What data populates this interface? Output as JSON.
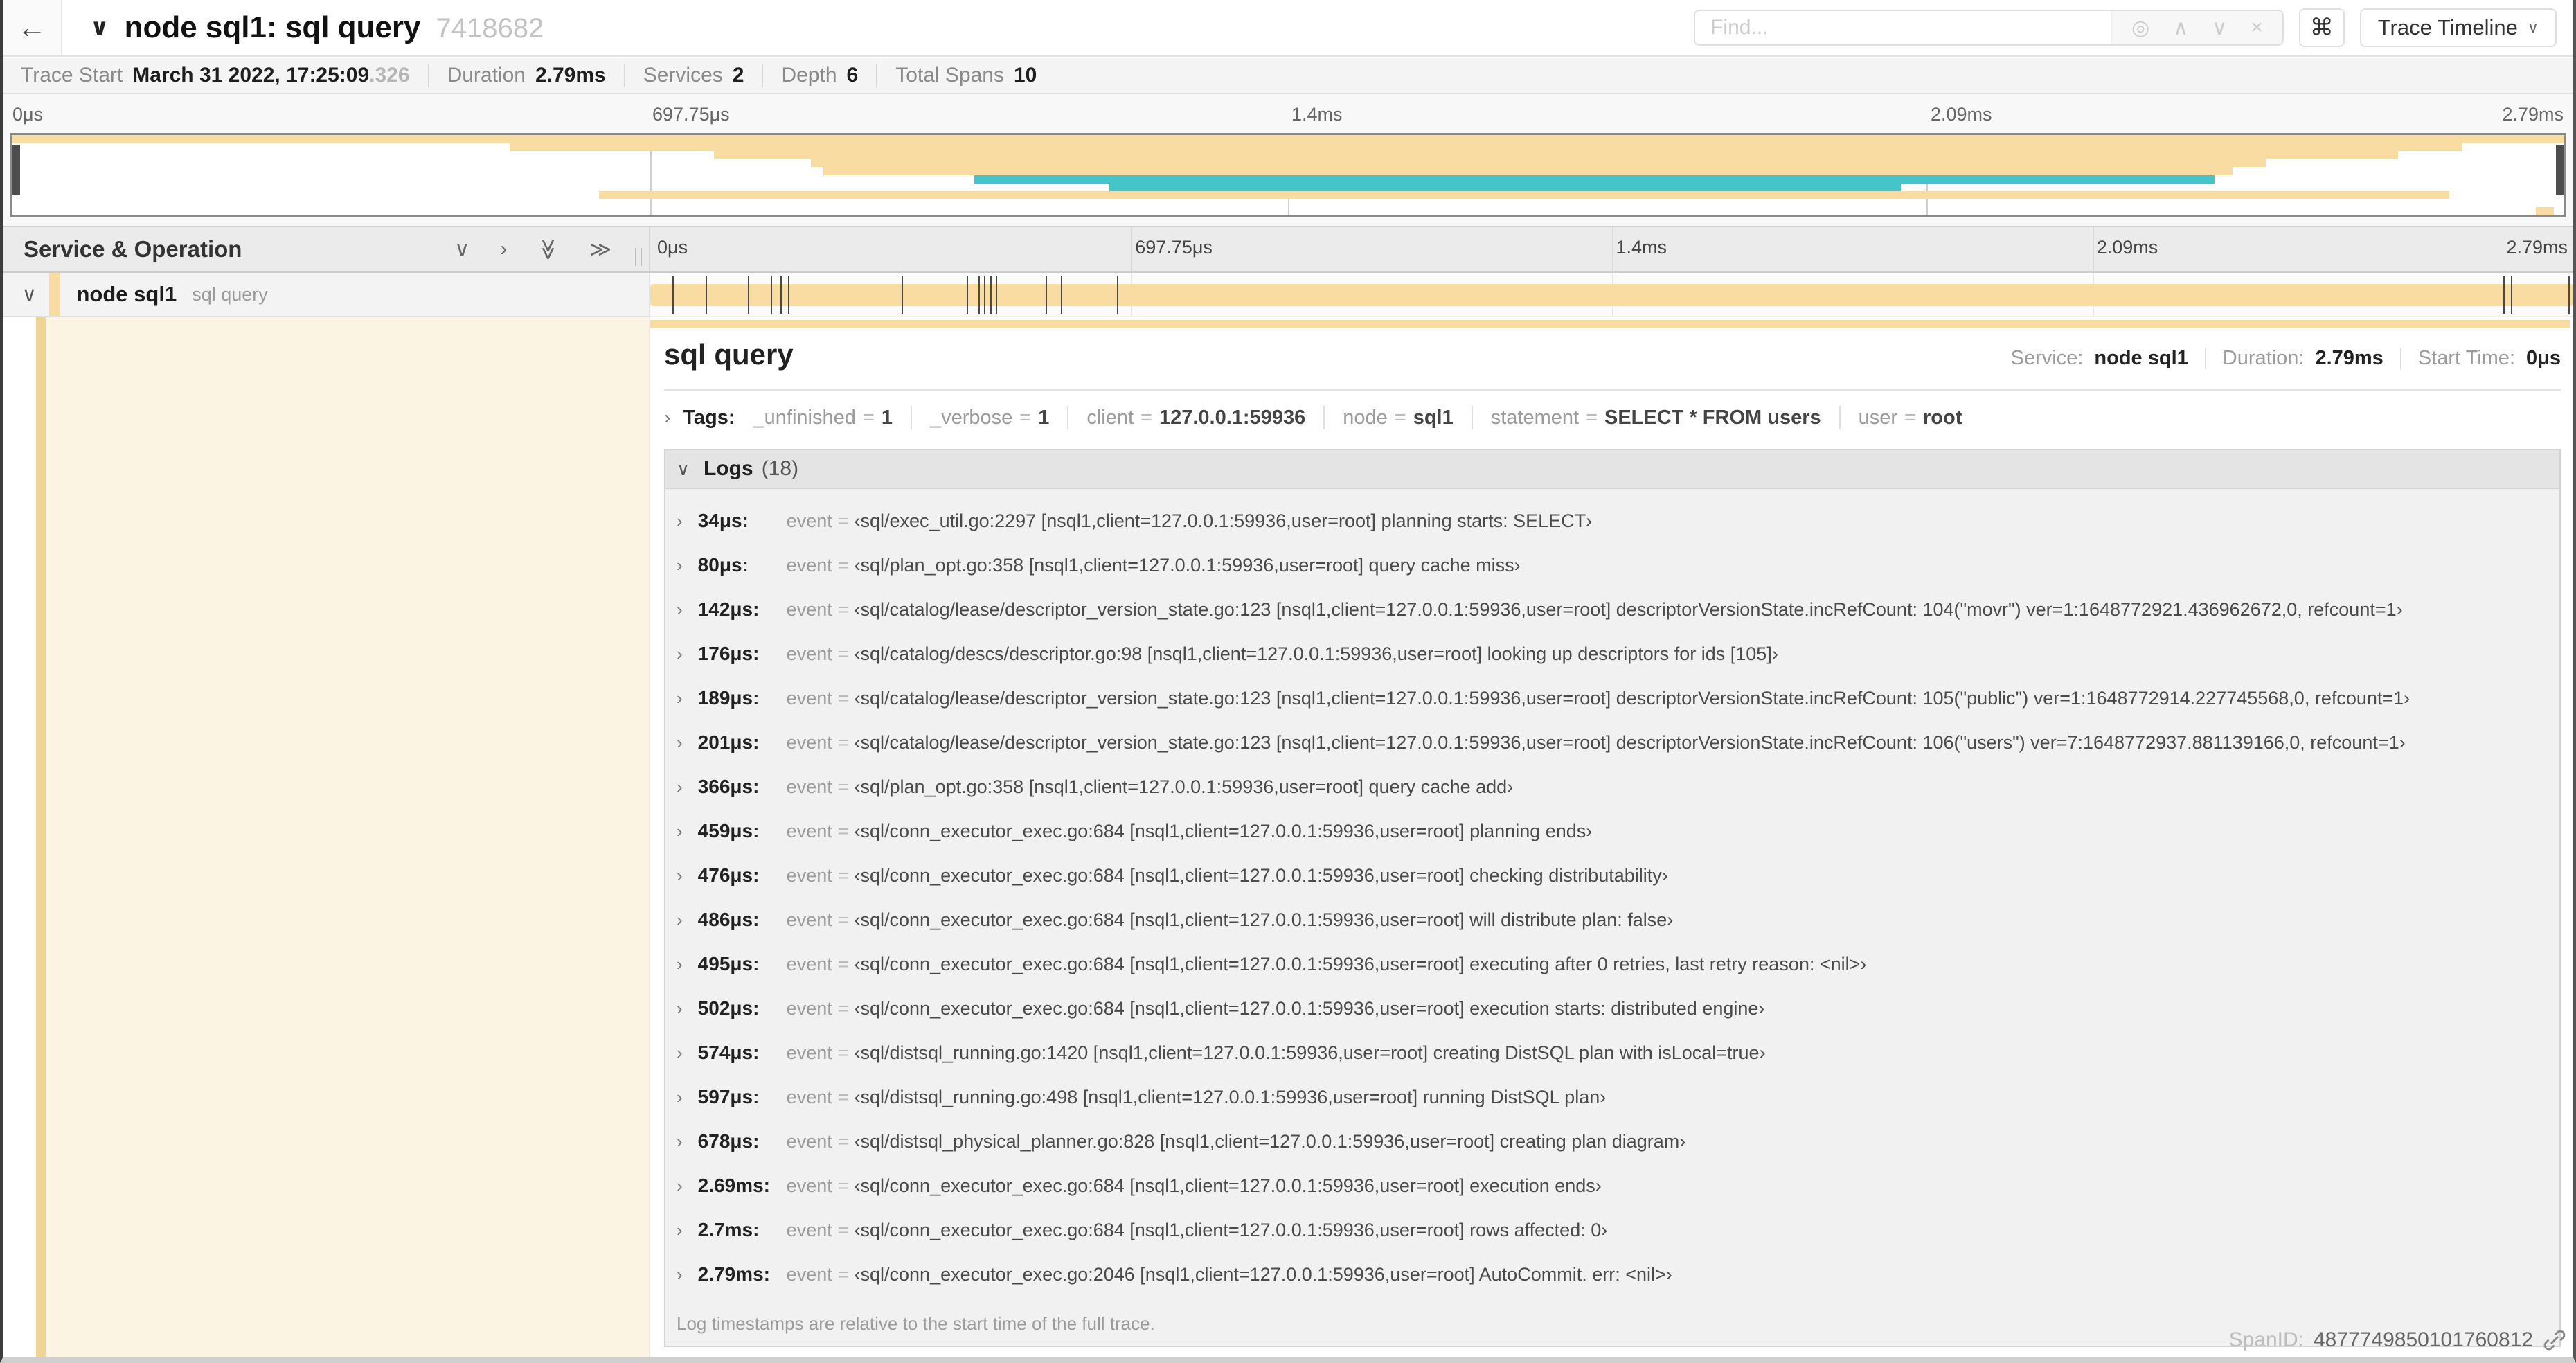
{
  "colors": {
    "tan": "#F8DCA1",
    "teal": "#45C5C9",
    "cream": "#FBF4E3",
    "accent_strip": "#F0D494"
  },
  "icons": {
    "back": "←",
    "chevron_down": "∨",
    "chevron_right": "›",
    "chevron_up": "∧",
    "double_chevron_right": "≫",
    "target": "◎",
    "close": "×",
    "command": "⌘"
  },
  "header": {
    "title": "node sql1: sql query",
    "trace_id": "7418682",
    "find_placeholder": "Find...",
    "view_selector": "Trace Timeline"
  },
  "summary": {
    "items": [
      {
        "label": "Trace Start",
        "value": "March 31 2022, 17:25:09",
        "muted_suffix": ".326"
      },
      {
        "label": "Duration",
        "value": "2.79ms"
      },
      {
        "label": "Services",
        "value": "2"
      },
      {
        "label": "Depth",
        "value": "6"
      },
      {
        "label": "Total Spans",
        "value": "10"
      }
    ]
  },
  "timeline": {
    "header_label": "Service & Operation",
    "axis_ticks": [
      {
        "label": "0μs",
        "pct": 0
      },
      {
        "label": "697.75μs",
        "pct": 25
      },
      {
        "label": "1.4ms",
        "pct": 50
      },
      {
        "label": "2.09ms",
        "pct": 75
      },
      {
        "label": "2.79ms",
        "pct": 100
      }
    ],
    "rows_total": 10,
    "minimap_bars": [
      {
        "row": 0,
        "start": 0,
        "end": 100,
        "color": "tan"
      },
      {
        "row": 1,
        "start": 19.5,
        "end": 96,
        "color": "tan"
      },
      {
        "row": 2,
        "start": 27.5,
        "end": 93.5,
        "color": "tan"
      },
      {
        "row": 3,
        "start": 31.3,
        "end": 88.3,
        "color": "tan"
      },
      {
        "row": 4,
        "start": 31.8,
        "end": 87,
        "color": "tan"
      },
      {
        "row": 5,
        "start": 37.7,
        "end": 86.3,
        "color": "teal"
      },
      {
        "row": 6,
        "start": 43,
        "end": 74,
        "color": "teal"
      },
      {
        "row": 7,
        "start": 23,
        "end": 95.5,
        "color": "tan"
      },
      {
        "row": 9,
        "start": 98.9,
        "end": 99.6,
        "color": "tan"
      }
    ]
  },
  "span_row": {
    "service": "node sql1",
    "operation": "sql query",
    "bar_start": 0,
    "bar_end": 100,
    "log_tick_pcts": [
      1.2,
      2.9,
      5.1,
      6.3,
      6.8,
      7.2,
      13.1,
      16.5,
      17.1,
      17.4,
      17.7,
      18.0,
      20.6,
      21.4,
      24.3,
      96.4,
      96.8,
      99.8
    ]
  },
  "detail": {
    "title": "sql query",
    "service_label": "Service:",
    "service": "node sql1",
    "duration_label": "Duration:",
    "duration": "2.79ms",
    "start_time_label": "Start Time:",
    "start_time": "0μs",
    "tags_label": "Tags:",
    "tags": [
      {
        "key": "_unfinished",
        "value": "1"
      },
      {
        "key": "_verbose",
        "value": "1"
      },
      {
        "key": "client",
        "value": "127.0.0.1:59936"
      },
      {
        "key": "node",
        "value": "sql1"
      },
      {
        "key": "statement",
        "value": "SELECT * FROM users"
      },
      {
        "key": "user",
        "value": "root"
      }
    ],
    "logs_label": "Logs",
    "logs_count": "(18)",
    "log_key": "event",
    "logs": [
      {
        "time": "34μs:",
        "value": "‹sql/exec_util.go:2297 [nsql1,client=127.0.0.1:59936,user=root] planning starts: SELECT›"
      },
      {
        "time": "80μs:",
        "value": "‹sql/plan_opt.go:358 [nsql1,client=127.0.0.1:59936,user=root] query cache miss›"
      },
      {
        "time": "142μs:",
        "value": "‹sql/catalog/lease/descriptor_version_state.go:123 [nsql1,client=127.0.0.1:59936,user=root] descriptorVersionState.incRefCount: 104(\"movr\") ver=1:1648772921.436962672,0, refcount=1›"
      },
      {
        "time": "176μs:",
        "value": "‹sql/catalog/descs/descriptor.go:98 [nsql1,client=127.0.0.1:59936,user=root] looking up descriptors for ids [105]›"
      },
      {
        "time": "189μs:",
        "value": "‹sql/catalog/lease/descriptor_version_state.go:123 [nsql1,client=127.0.0.1:59936,user=root] descriptorVersionState.incRefCount: 105(\"public\") ver=1:1648772914.227745568,0, refcount=1›"
      },
      {
        "time": "201μs:",
        "value": "‹sql/catalog/lease/descriptor_version_state.go:123 [nsql1,client=127.0.0.1:59936,user=root] descriptorVersionState.incRefCount: 106(\"users\") ver=7:1648772937.881139166,0, refcount=1›"
      },
      {
        "time": "366μs:",
        "value": "‹sql/plan_opt.go:358 [nsql1,client=127.0.0.1:59936,user=root] query cache add›"
      },
      {
        "time": "459μs:",
        "value": "‹sql/conn_executor_exec.go:684 [nsql1,client=127.0.0.1:59936,user=root] planning ends›"
      },
      {
        "time": "476μs:",
        "value": "‹sql/conn_executor_exec.go:684 [nsql1,client=127.0.0.1:59936,user=root] checking distributability›"
      },
      {
        "time": "486μs:",
        "value": "‹sql/conn_executor_exec.go:684 [nsql1,client=127.0.0.1:59936,user=root] will distribute plan: false›"
      },
      {
        "time": "495μs:",
        "value": "‹sql/conn_executor_exec.go:684 [nsql1,client=127.0.0.1:59936,user=root] executing after 0 retries, last retry reason: <nil>›"
      },
      {
        "time": "502μs:",
        "value": "‹sql/conn_executor_exec.go:684 [nsql1,client=127.0.0.1:59936,user=root] execution starts: distributed engine›"
      },
      {
        "time": "574μs:",
        "value": "‹sql/distsql_running.go:1420 [nsql1,client=127.0.0.1:59936,user=root] creating DistSQL plan with isLocal=true›"
      },
      {
        "time": "597μs:",
        "value": "‹sql/distsql_running.go:498 [nsql1,client=127.0.0.1:59936,user=root] running DistSQL plan›"
      },
      {
        "time": "678μs:",
        "value": "‹sql/distsql_physical_planner.go:828 [nsql1,client=127.0.0.1:59936,user=root] creating plan diagram›"
      },
      {
        "time": "2.69ms:",
        "value": "‹sql/conn_executor_exec.go:684 [nsql1,client=127.0.0.1:59936,user=root] execution ends›"
      },
      {
        "time": "2.7ms:",
        "value": "‹sql/conn_executor_exec.go:684 [nsql1,client=127.0.0.1:59936,user=root] rows affected: 0›"
      },
      {
        "time": "2.79ms:",
        "value": "‹sql/conn_executor_exec.go:2046 [nsql1,client=127.0.0.1:59936,user=root] AutoCommit. err: <nil>›"
      }
    ],
    "footer_note": "Log timestamps are relative to the start time of the full trace.",
    "span_id_label": "SpanID:",
    "span_id": "4877749850101760812"
  }
}
